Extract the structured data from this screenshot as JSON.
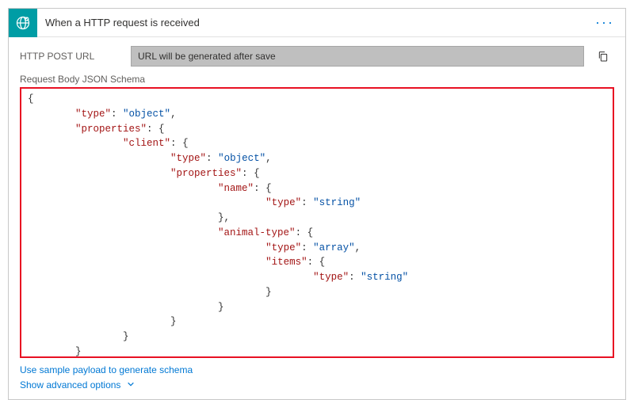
{
  "header": {
    "title": "When a HTTP request is received",
    "icon_name": "http-globe-icon"
  },
  "url_row": {
    "label": "HTTP POST URL",
    "value": "URL will be generated after save"
  },
  "schema": {
    "label": "Request Body JSON Schema",
    "json_lines": [
      {
        "indent": 0,
        "text": "{"
      },
      {
        "indent": 2,
        "key": "\"type\"",
        "colon": ": ",
        "val": "\"object\"",
        "comma": ","
      },
      {
        "indent": 2,
        "key": "\"properties\"",
        "colon": ": ",
        "brace": "{"
      },
      {
        "indent": 4,
        "key": "\"client\"",
        "colon": ": ",
        "brace": "{"
      },
      {
        "indent": 6,
        "key": "\"type\"",
        "colon": ": ",
        "val": "\"object\"",
        "comma": ","
      },
      {
        "indent": 6,
        "key": "\"properties\"",
        "colon": ": ",
        "brace": "{"
      },
      {
        "indent": 8,
        "key": "\"name\"",
        "colon": ": ",
        "brace": "{"
      },
      {
        "indent": 10,
        "key": "\"type\"",
        "colon": ": ",
        "val": "\"string\""
      },
      {
        "indent": 8,
        "brace_close": "},"
      },
      {
        "indent": 8,
        "key": "\"animal-type\"",
        "colon": ": ",
        "brace": "{"
      },
      {
        "indent": 10,
        "key": "\"type\"",
        "colon": ": ",
        "val": "\"array\"",
        "comma": ","
      },
      {
        "indent": 10,
        "key": "\"items\"",
        "colon": ": ",
        "brace": "{"
      },
      {
        "indent": 12,
        "key": "\"type\"",
        "colon": ": ",
        "val": "\"string\""
      },
      {
        "indent": 10,
        "brace_close": "}"
      },
      {
        "indent": 8,
        "brace_close": "}"
      },
      {
        "indent": 6,
        "brace_close": "}"
      },
      {
        "indent": 4,
        "brace_close": "}"
      },
      {
        "indent": 2,
        "brace_close": "}"
      },
      {
        "indent": 0,
        "brace_close": "}"
      }
    ]
  },
  "footer": {
    "sample_link": "Use sample payload to generate schema",
    "advanced_link": "Show advanced options"
  }
}
